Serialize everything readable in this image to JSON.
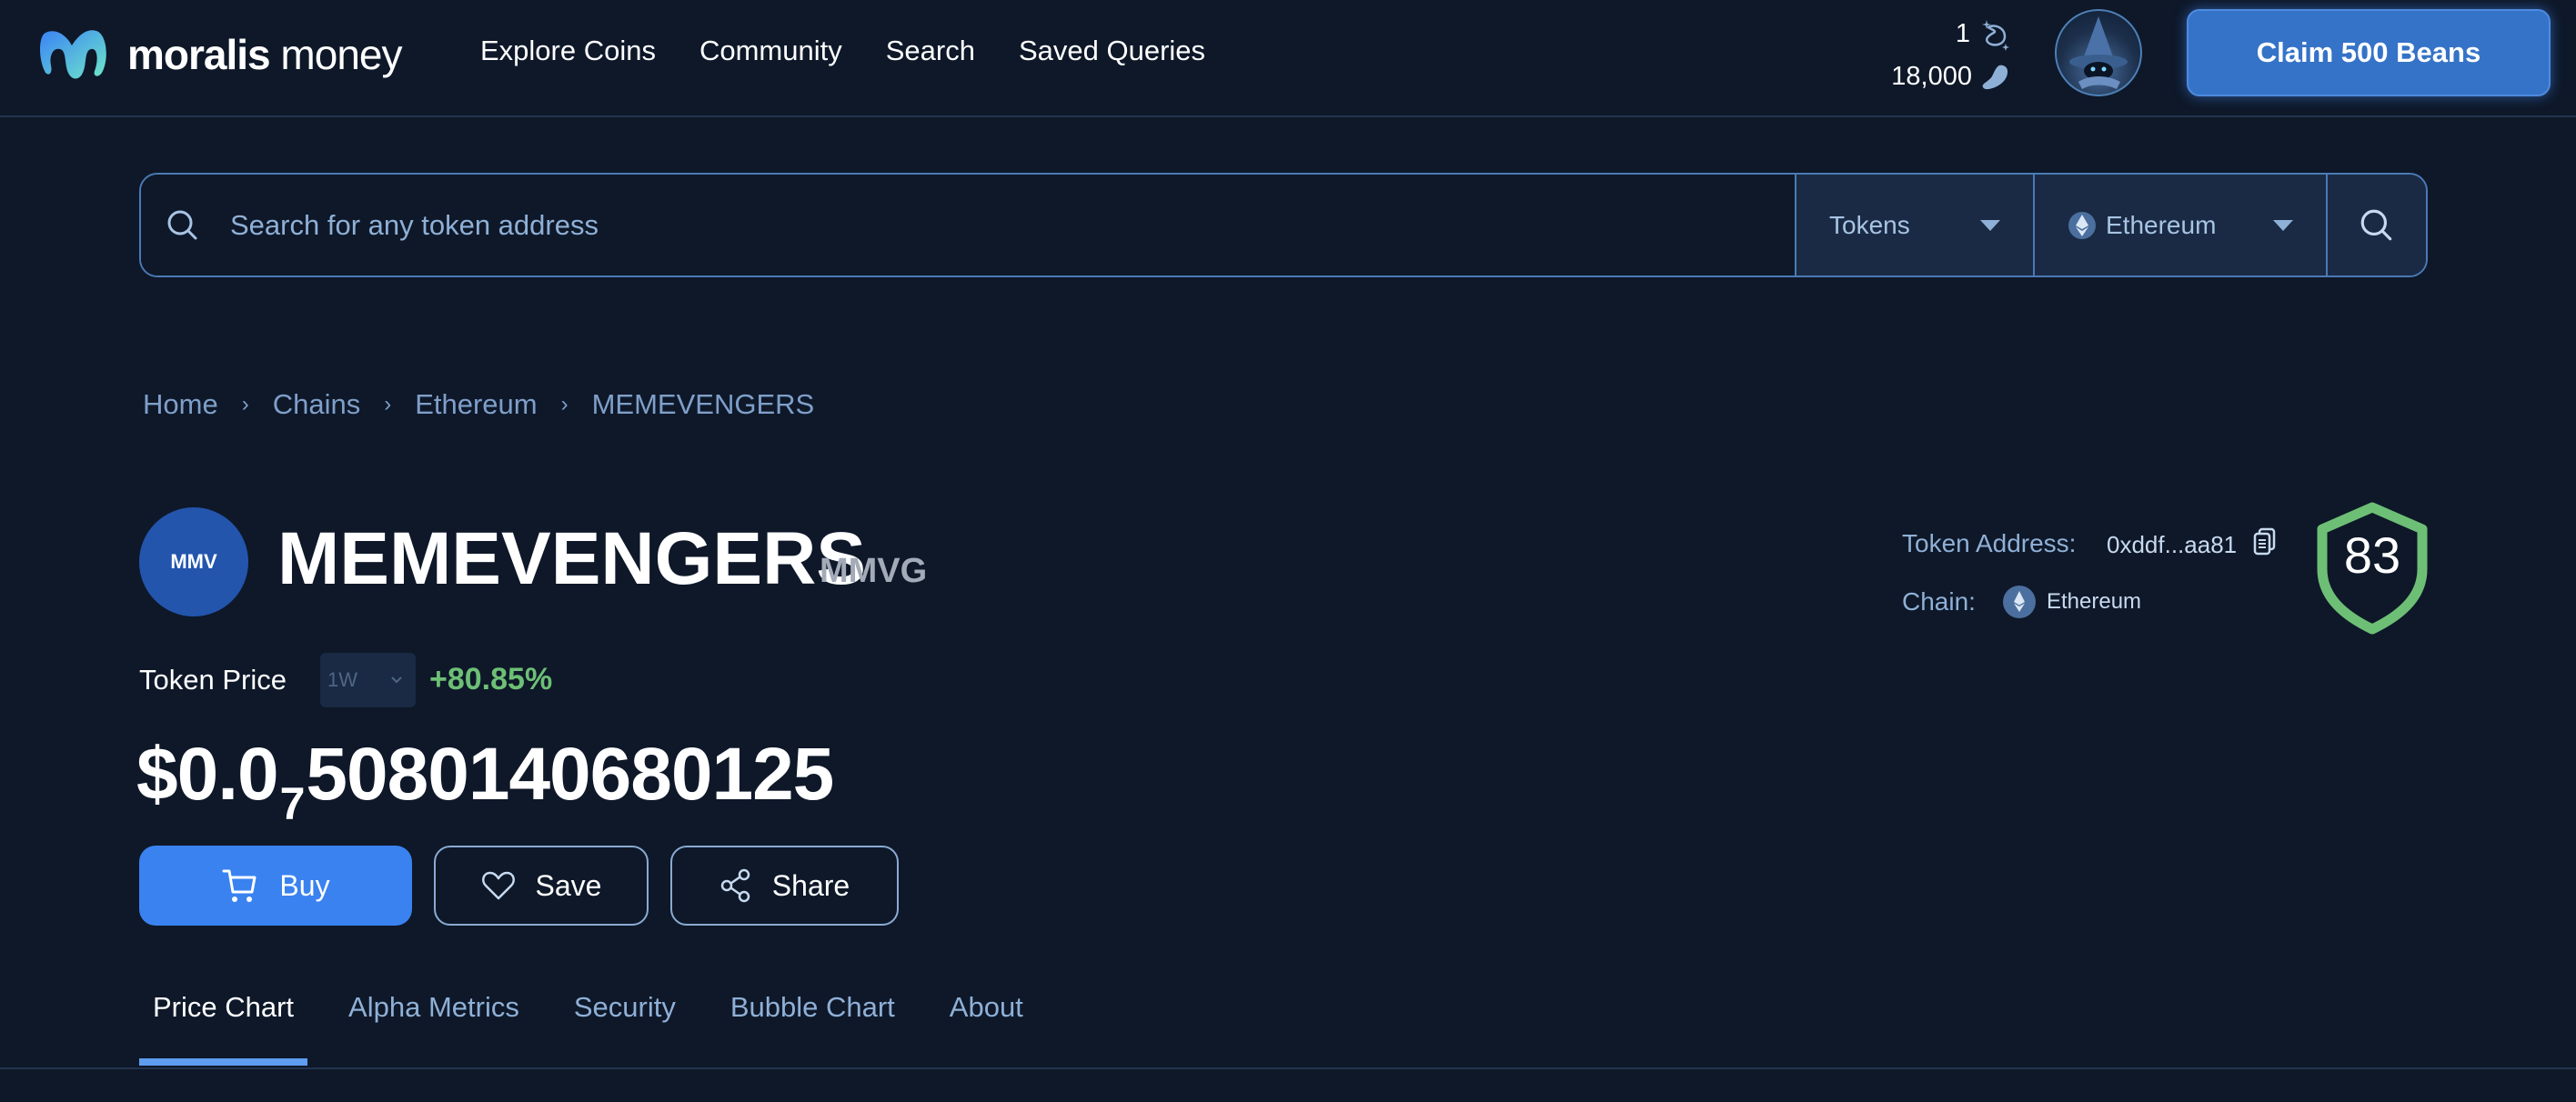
{
  "header": {
    "logo_bold": "moralis",
    "logo_light": " money",
    "nav": [
      "Explore Coins",
      "Community",
      "Search",
      "Saved Queries"
    ],
    "streak_count": "1",
    "beans_count": "18,000",
    "claim_button": "Claim 500 Beans"
  },
  "search": {
    "placeholder": "Search for any token address",
    "type_select": "Tokens",
    "chain_select": "Ethereum"
  },
  "breadcrumb": [
    "Home",
    "Chains",
    "Ethereum",
    "MEMEVENGERS"
  ],
  "token": {
    "logo_text": "MMV",
    "name": "MEMEVENGERS",
    "symbol": "MMVG",
    "price_label": "Token Price",
    "period": "1W",
    "change": "+80.85%",
    "price_prefix": "$0.0",
    "price_zeros_subscript": "7",
    "price_digits": "5080140680125",
    "address_label": "Token Address:",
    "address": "0xddf...aa81",
    "chain_label": "Chain:",
    "chain": "Ethereum",
    "score": "83"
  },
  "actions": {
    "buy": "Buy",
    "save": "Save",
    "share": "Share"
  },
  "tabs": [
    {
      "label": "Price Chart",
      "active": true
    },
    {
      "label": "Alpha Metrics",
      "active": false
    },
    {
      "label": "Security",
      "active": false
    },
    {
      "label": "Bubble Chart",
      "active": false
    },
    {
      "label": "About",
      "active": false
    }
  ],
  "colors": {
    "background": "#0e1829",
    "accent": "#3a82f0",
    "positive": "#6dbf75",
    "muted_text": "#8fb0d6"
  }
}
